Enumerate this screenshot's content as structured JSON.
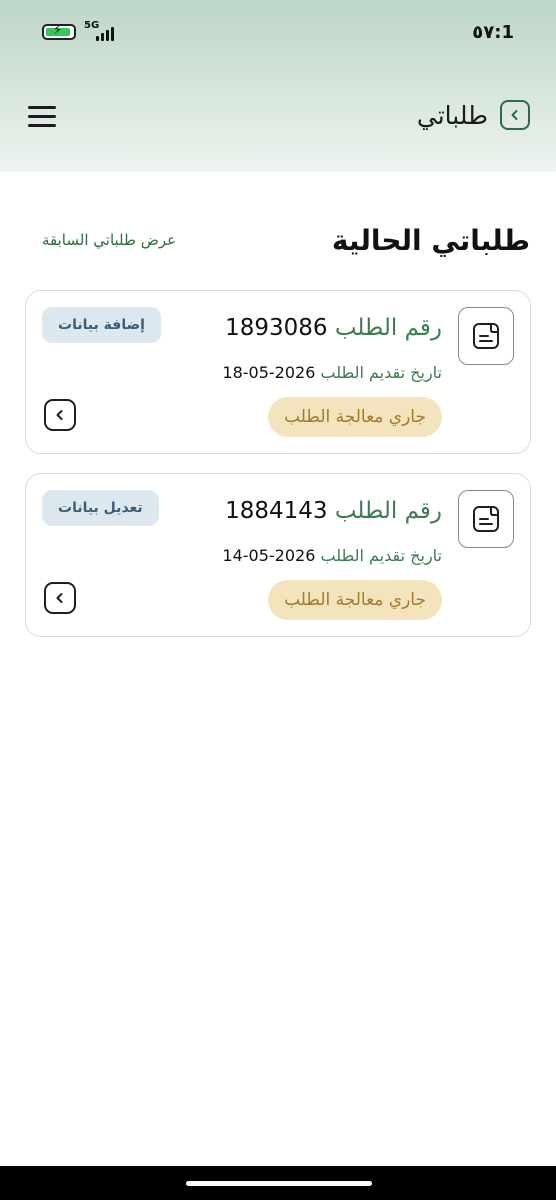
{
  "status_bar": {
    "time": "1:٥٧",
    "network": "5G"
  },
  "header": {
    "title": "طلباتي"
  },
  "section": {
    "title": "طلباتي الحالية",
    "previous_link": "عرض طلباتي السابقة"
  },
  "requests": [
    {
      "number_label": "رقم الطلب",
      "number": "1893086",
      "date_label": "تاريخ تقديم الطلب",
      "date": "2026-05-18",
      "status": "جاري معالجة الطلب",
      "action": "إضافة بيانات"
    },
    {
      "number_label": "رقم الطلب",
      "number": "1884143",
      "date_label": "تاريخ تقديم الطلب",
      "date": "2026-05-14",
      "status": "جاري معالجة الطلب",
      "action": "تعديل بيانات"
    }
  ],
  "colors": {
    "brand_green": "#2e6a45",
    "status_bg": "#f3e4bd",
    "status_text": "#a37b2b",
    "action_bg": "#dde7ee",
    "action_text": "#3b5d7a"
  }
}
